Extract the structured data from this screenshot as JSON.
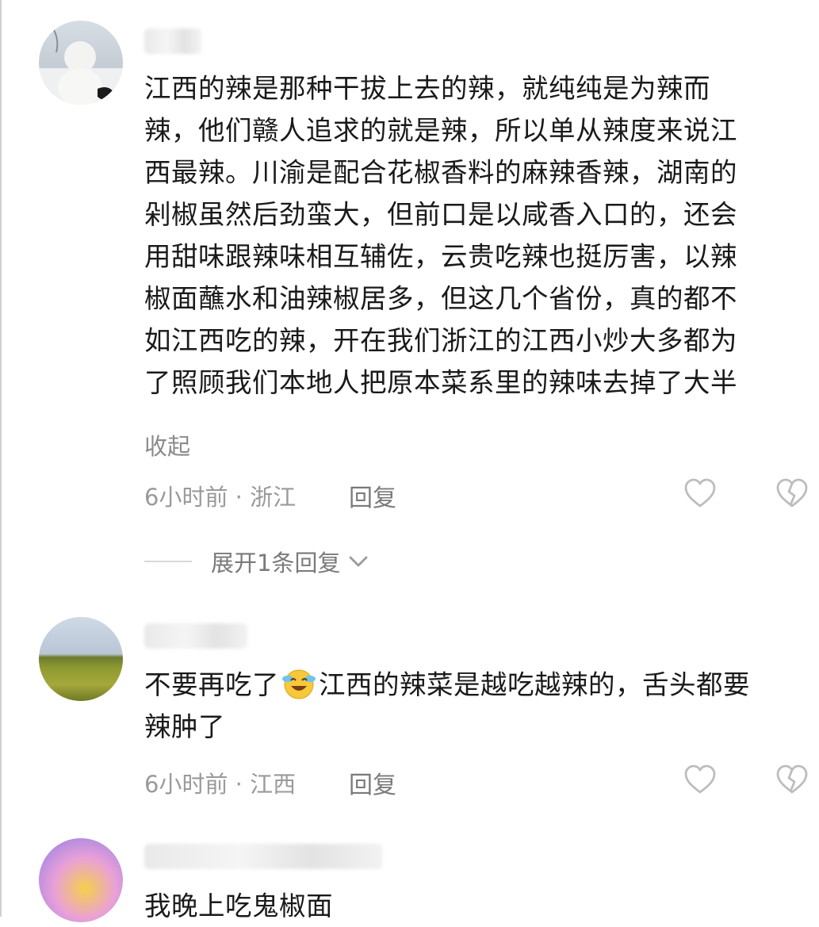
{
  "comments": [
    {
      "lines": [
        "江西的辣是那种干拔上去的辣，就纯纯是为辣而",
        "辣，他们赣人追求的就是辣，所以单从辣度来说江",
        "西最辣。川渝是配合花椒香料的麻辣香辣，湖南的",
        "剁椒虽然后劲蛮大，但前口是以咸香入口的，还会",
        "用甜味跟辣味相互辅佐，云贵吃辣也挺厉害，以辣",
        "椒面蘸水和油辣椒居多，但这几个省份，真的都不",
        "如江西吃的辣，开在我们浙江的江西小炒大多都为",
        "了照顾我们本地人把原本菜系里的辣味去掉了大半"
      ],
      "collapse_label": "收起",
      "meta": "6小时前 · 浙江",
      "reply_label": "回复",
      "expand_label": "展开1条回复"
    },
    {
      "line1_before": "不要再吃了",
      "line1_after": "江西的辣菜是越吃越辣的，舌头都要",
      "line2": "辣肿了",
      "meta": "6小时前 · 江西",
      "reply_label": "回复"
    },
    {
      "text": "我晚上吃鬼椒面"
    }
  ],
  "icons": {
    "like": "heart-outline-icon",
    "dislike": "broken-heart-icon",
    "expand": "chevron-down-icon",
    "emoji": "crying-laughing-emoji"
  },
  "colors": {
    "text": "#1a1a1a",
    "meta": "#9a9a9a",
    "icon": "#bdbdbd"
  }
}
